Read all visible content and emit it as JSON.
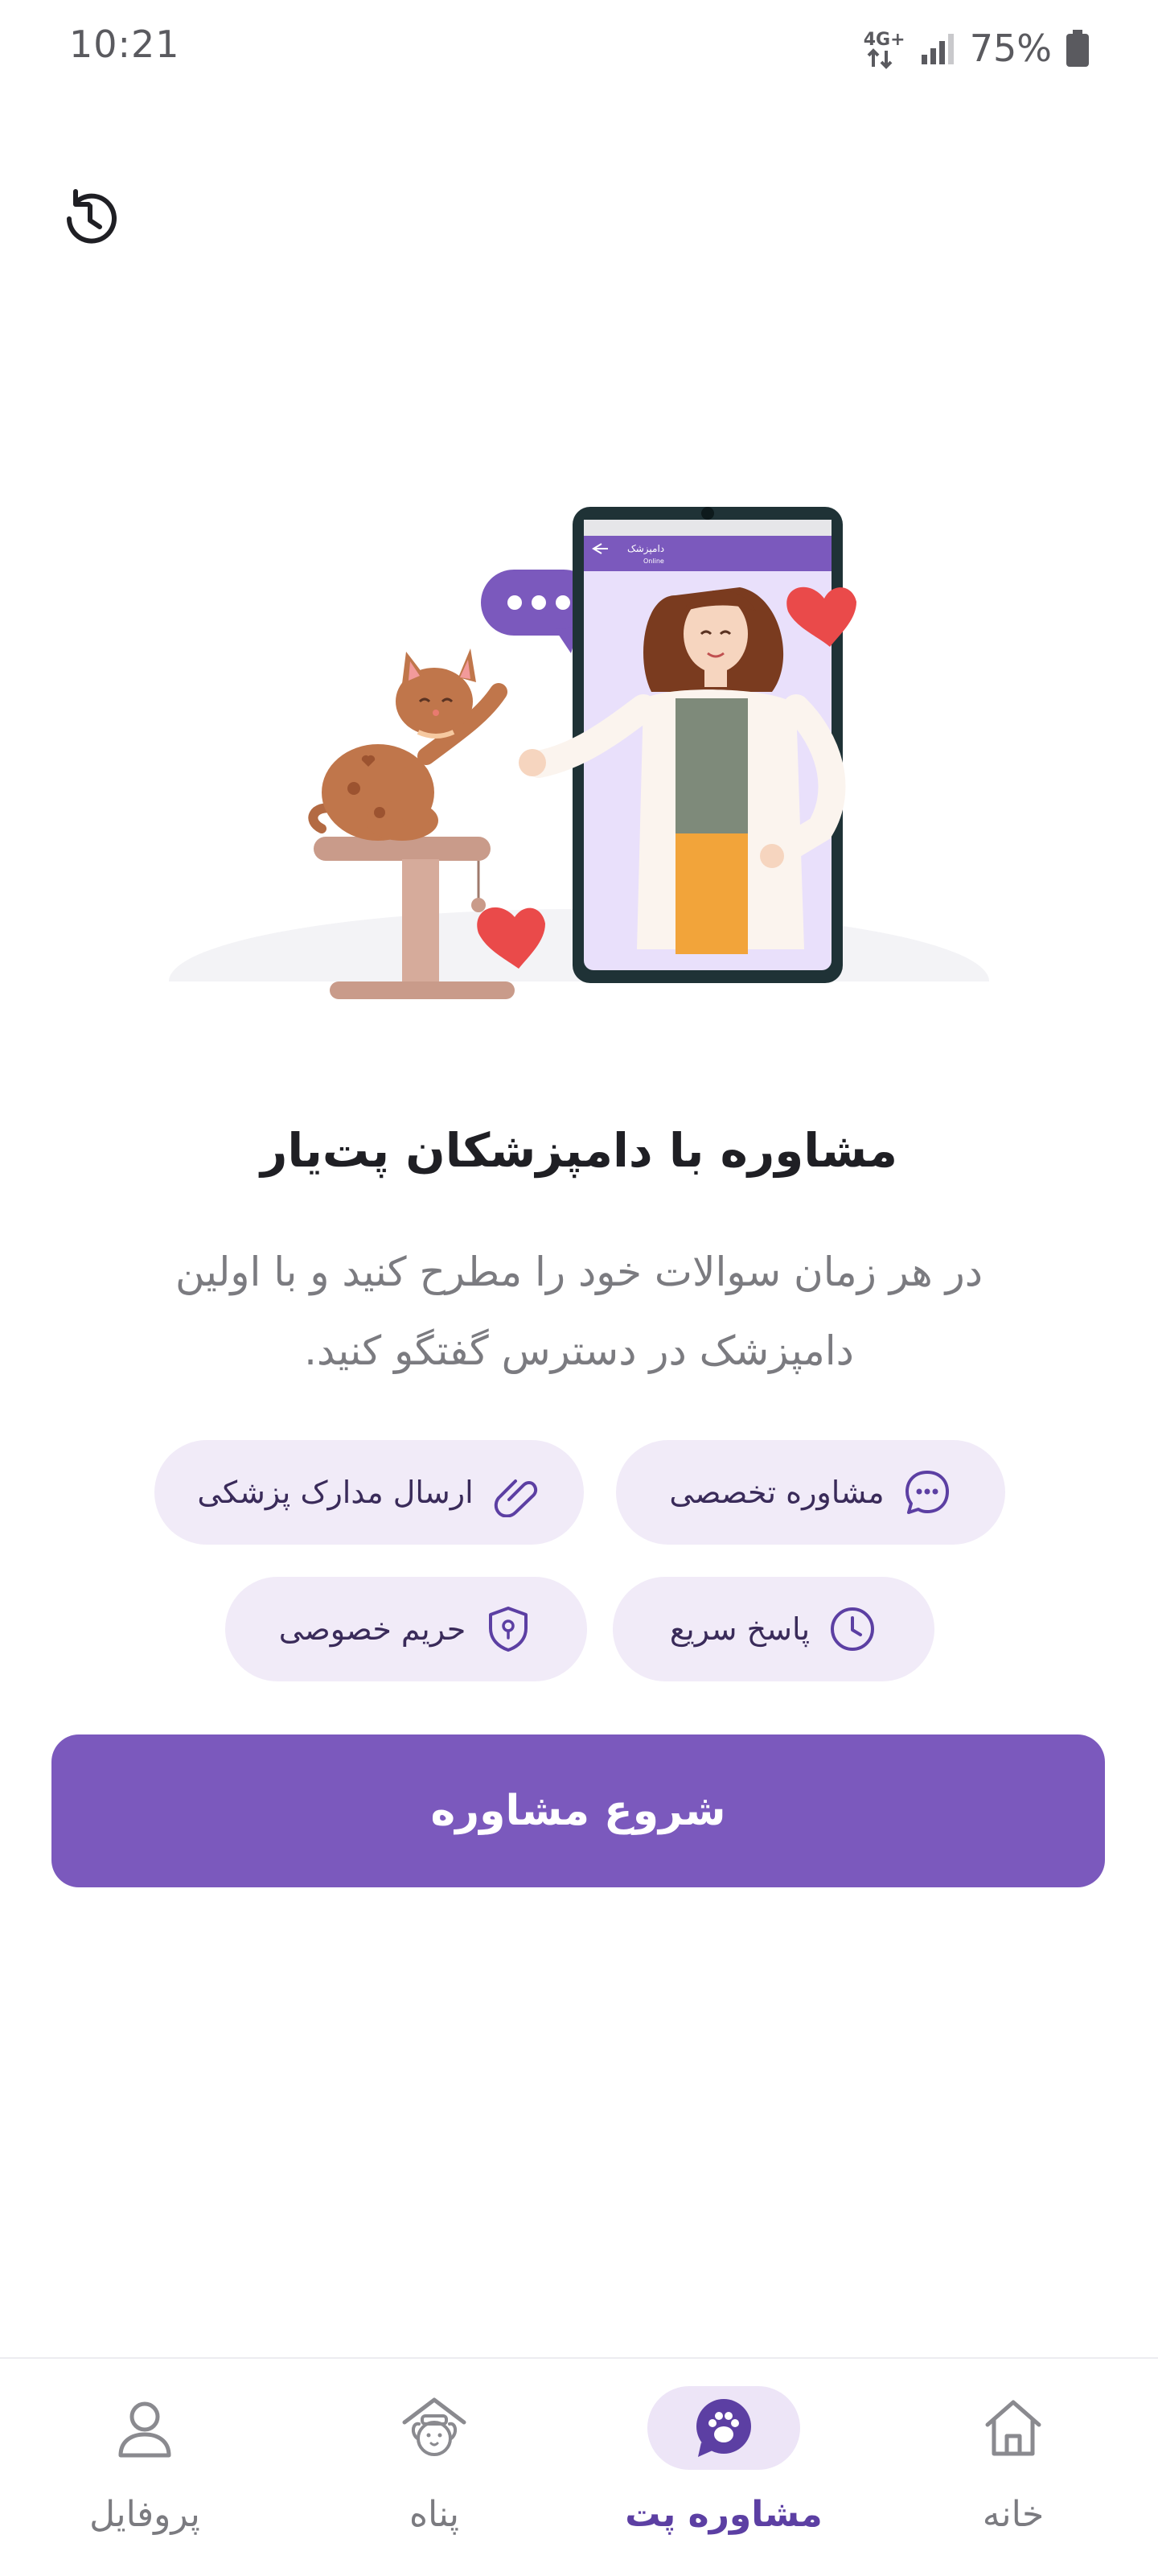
{
  "status_bar": {
    "time": "10:21",
    "network": "4G+",
    "battery": "75%"
  },
  "header": {
    "history_icon": "history-icon"
  },
  "main": {
    "title": "مشاوره با دامپزشکان پت‌یار",
    "subtitle_line1": "در هر زمان سوالات خود را مطرح کنید و با اولین",
    "subtitle_line2": "دامپزشک در دسترس گفتگو کنید.",
    "features": [
      {
        "label": "مشاوره تخصصی",
        "icon": "chat-bubble-icon"
      },
      {
        "label": "ارسال مدارک پزشکی",
        "icon": "attachment-icon"
      },
      {
        "label": "پاسخ سریع",
        "icon": "clock-icon"
      },
      {
        "label": "حریم خصوصی",
        "icon": "shield-icon"
      }
    ],
    "start_button": "شروع مشاوره"
  },
  "illustration": {
    "phone_header": "دامپزشک",
    "phone_status": "Online"
  },
  "bottom_nav": {
    "items": [
      {
        "label": "خانه",
        "icon": "home-icon",
        "active": false
      },
      {
        "label": "مشاوره پت",
        "icon": "paw-chat-icon",
        "active": true
      },
      {
        "label": "پناه",
        "icon": "shelter-icon",
        "active": false
      },
      {
        "label": "پروفایل",
        "icon": "user-icon",
        "active": false
      }
    ]
  },
  "colors": {
    "primary": "#7B59BD",
    "chip_bg": "#F1EBF8",
    "nav_active_bg": "#EDE5F7",
    "nav_active_text": "#5C3FA3",
    "muted_text": "#7B7B80"
  }
}
